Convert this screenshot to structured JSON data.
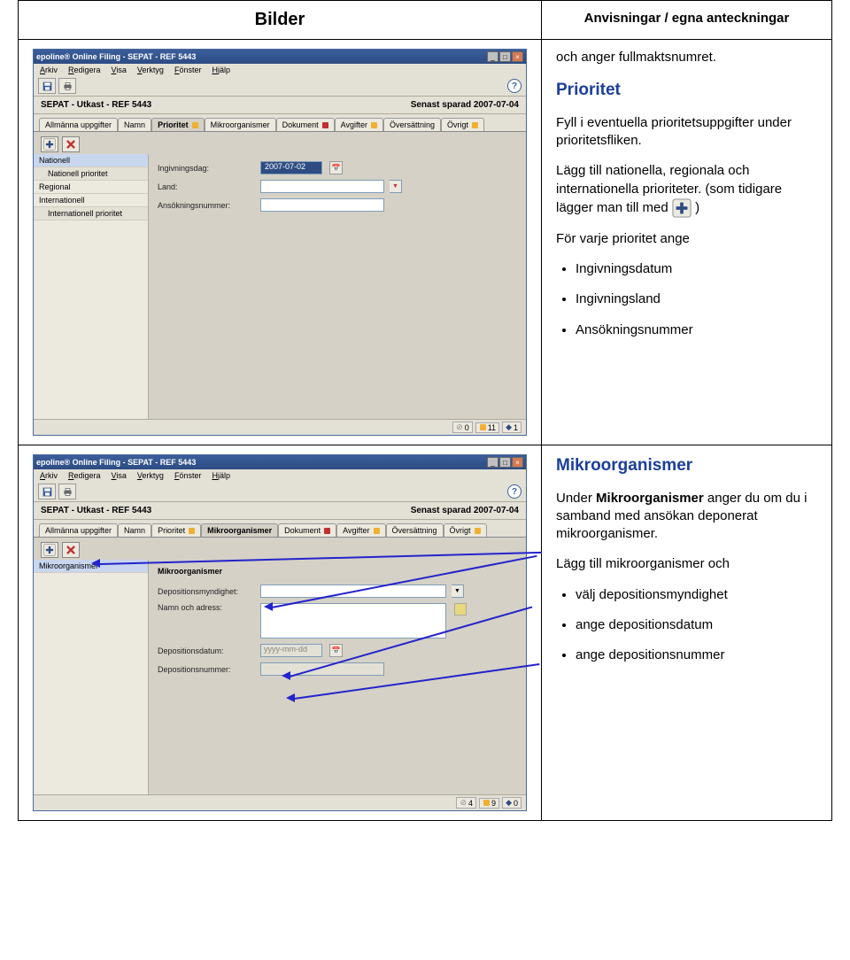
{
  "headers": {
    "left": "Bilder",
    "right": "Anvisningar / egna anteckningar"
  },
  "row1": {
    "right": {
      "intro": "och anger fullmaktsnumret.",
      "section_title": "Prioritet",
      "p1": "Fyll i eventuella prioritetsuppgifter under prioritetsfliken.",
      "p2_a": "Lägg till nationella, regionala och internationella prioriteter. (som tidigare lägger man till med ",
      "p2_b": ")",
      "p3": "För varje prioritet ange",
      "bullets": [
        "Ingivningsdatum",
        "Ingivningsland",
        "Ansökningsnummer"
      ]
    },
    "app": {
      "title": "epoline® Online Filing - SEPAT - REF 5443",
      "menus": [
        "Arkiv",
        "Redigera",
        "Visa",
        "Verktyg",
        "Fönster",
        "Hjälp"
      ],
      "subhead_left": "SEPAT - Utkast - REF 5443",
      "subhead_right": "Senast sparad 2007-07-04",
      "tabs": [
        {
          "label": "Allmänna uppgifter",
          "mark": ""
        },
        {
          "label": "Namn",
          "mark": ""
        },
        {
          "label": "Prioritet",
          "mark": "warn",
          "active": true
        },
        {
          "label": "Mikroorganismer",
          "mark": ""
        },
        {
          "label": "Dokument",
          "mark": "err"
        },
        {
          "label": "Avgifter",
          "mark": "warn"
        },
        {
          "label": "Översättning",
          "mark": ""
        },
        {
          "label": "Övrigt",
          "mark": "warn"
        }
      ],
      "side": [
        "Nationell",
        "Nationell prioritet",
        "Regional",
        "Internationell",
        "Internationell prioritet"
      ],
      "fields": {
        "ingivningsdag": "Ingivningsdag:",
        "ingivningsdag_val": "2007-07-02",
        "land": "Land:",
        "ansok": "Ansökningsnummer:"
      },
      "status": {
        "gray": "0",
        "warn": "11",
        "info": "1"
      }
    }
  },
  "row2": {
    "right": {
      "section_title": "Mikroorganismer",
      "p1_a": "Under ",
      "p1_bold": "Mikroorganismer",
      "p1_b": " anger du om du i samband med ansökan deponerat mikroorganismer.",
      "p2": "Lägg till mikroorganismer och",
      "bullets": [
        "välj depositionsmyndighet",
        "ange depositionsdatum",
        "ange depositionsnummer"
      ]
    },
    "app": {
      "title": "epoline® Online Filing - SEPAT - REF 5443",
      "menus": [
        "Arkiv",
        "Redigera",
        "Visa",
        "Verktyg",
        "Fönster",
        "Hjälp"
      ],
      "subhead_left": "SEPAT - Utkast - REF 5443",
      "subhead_right": "Senast sparad 2007-07-04",
      "tabs": [
        {
          "label": "Allmänna uppgifter",
          "mark": ""
        },
        {
          "label": "Namn",
          "mark": ""
        },
        {
          "label": "Prioritet",
          "mark": "warn"
        },
        {
          "label": "Mikroorganismer",
          "mark": "",
          "active": true
        },
        {
          "label": "Dokument",
          "mark": "err"
        },
        {
          "label": "Avgifter",
          "mark": "warn"
        },
        {
          "label": "Översättning",
          "mark": ""
        },
        {
          "label": "Övrigt",
          "mark": "warn"
        }
      ],
      "side": [
        "Mikroorganismer"
      ],
      "panel_title": "Mikroorganismer",
      "fields": {
        "deposit_authority": "Depositionsmyndighet:",
        "name_addr": "Namn och adress:",
        "deposit_date": "Depositionsdatum:",
        "deposit_date_val": "yyyy-mm-dd",
        "deposit_num": "Depositionsnummer:"
      },
      "status": {
        "gray": "4",
        "warn": "9",
        "info": "0"
      }
    }
  }
}
